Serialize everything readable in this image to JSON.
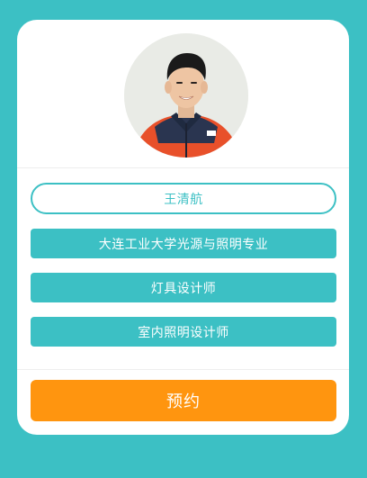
{
  "profile": {
    "name": "王清航",
    "tags": [
      {
        "label": "大连工业大学光源与照明专业"
      },
      {
        "label": "灯具设计师"
      },
      {
        "label": "室内照明设计师"
      }
    ]
  },
  "actions": {
    "book_label": "预约"
  },
  "colors": {
    "background": "#3cc0c4",
    "accent": "#3cc0c4",
    "primary_button": "#ff950f",
    "card": "#ffffff"
  }
}
